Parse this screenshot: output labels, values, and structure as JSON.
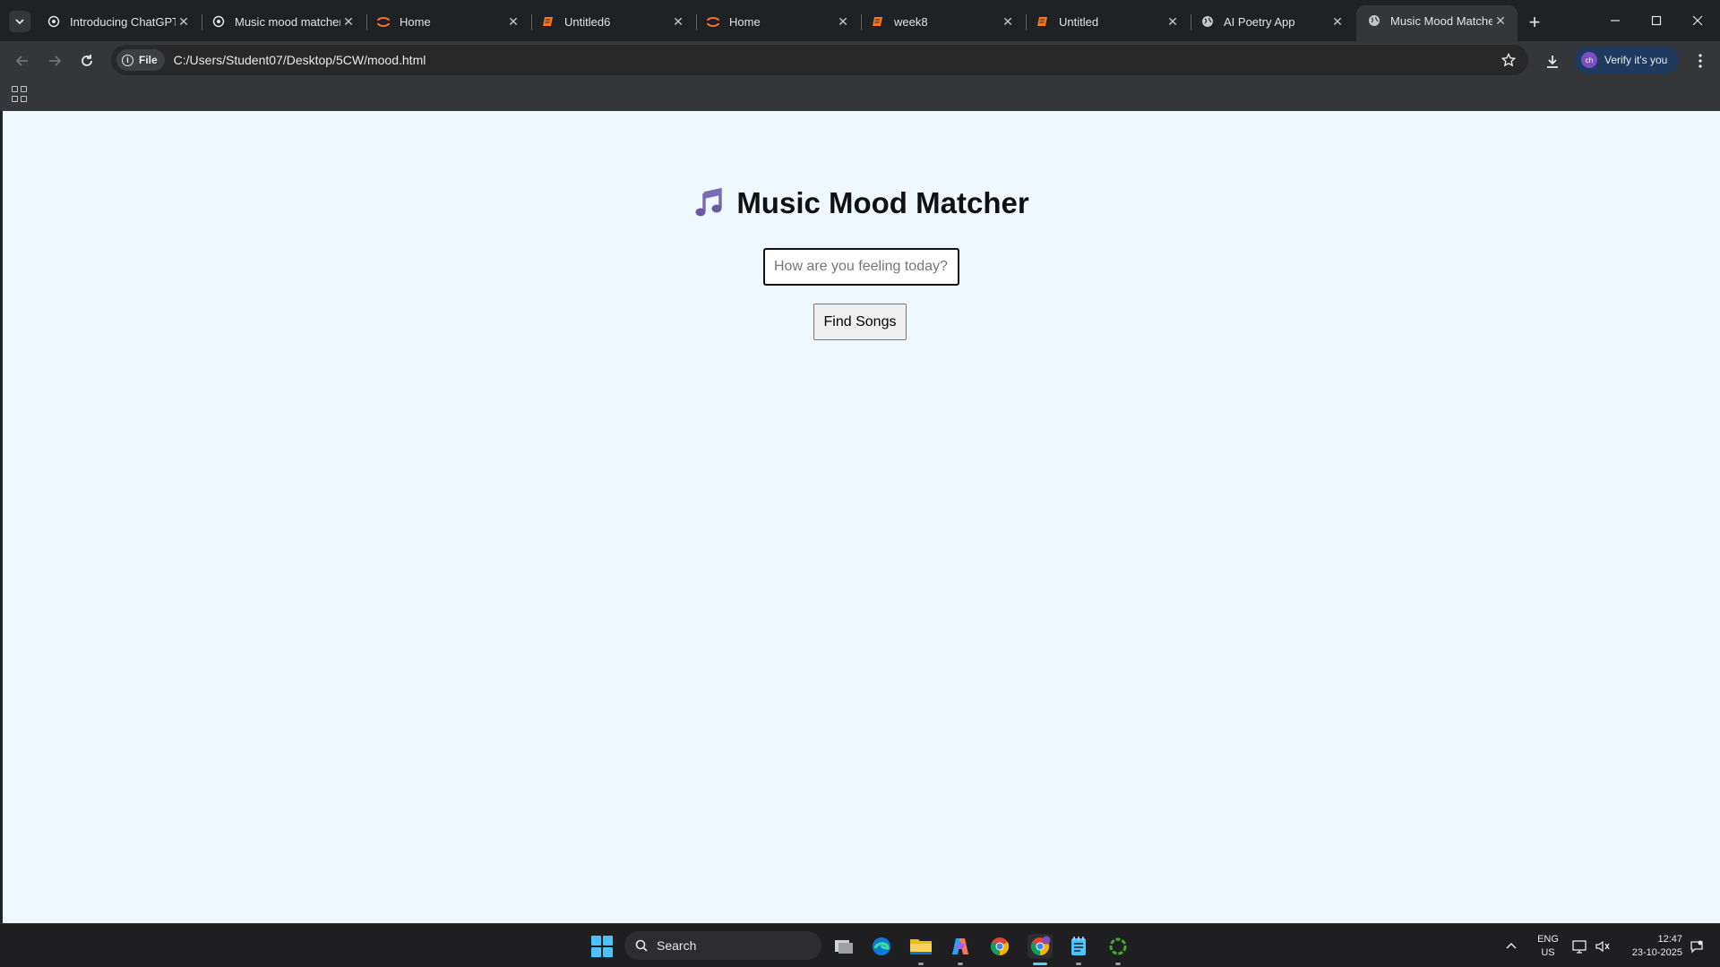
{
  "browser": {
    "tabs": [
      {
        "title": "Introducing ChatGPT",
        "icon": "openai-icon",
        "active": false
      },
      {
        "title": "Music mood matcher",
        "icon": "openai-icon",
        "active": false
      },
      {
        "title": "Home",
        "icon": "jupyter-icon",
        "active": false
      },
      {
        "title": "Untitled6",
        "icon": "notebook-icon",
        "active": false
      },
      {
        "title": "Home",
        "icon": "jupyter-icon",
        "active": false
      },
      {
        "title": "week8",
        "icon": "notebook-icon",
        "active": false
      },
      {
        "title": "Untitled",
        "icon": "notebook-icon",
        "active": false
      },
      {
        "title": "AI Poetry App",
        "icon": "globe-icon",
        "active": false
      },
      {
        "title": "Music Mood Matcher",
        "icon": "globe-icon",
        "active": true
      }
    ],
    "address": {
      "scheme_label": "File",
      "url": "C:/Users/Student07/Desktop/5CW/mood.html"
    },
    "profile": {
      "avatar_text": "ch",
      "label": "Verify it's you"
    }
  },
  "page": {
    "title": "Music Mood Matcher",
    "title_icon": "music-note-icon",
    "input_placeholder": "How are you feeling today?",
    "input_value": "",
    "button_label": "Find Songs"
  },
  "taskbar": {
    "search_label": "Search",
    "pinned": [
      "task-view-icon",
      "edge-icon",
      "file-explorer-icon",
      "copilot-icon",
      "chrome-icon",
      "chrome-profile-icon",
      "notepad-icon",
      "anaconda-icon"
    ],
    "language": {
      "line1": "ENG",
      "line2": "US"
    },
    "time": "12:47",
    "date": "23-10-2025"
  },
  "colors": {
    "page_background": "#f0f8ff",
    "accent": "#60cdff",
    "note_icon": "#7b6bb0"
  }
}
